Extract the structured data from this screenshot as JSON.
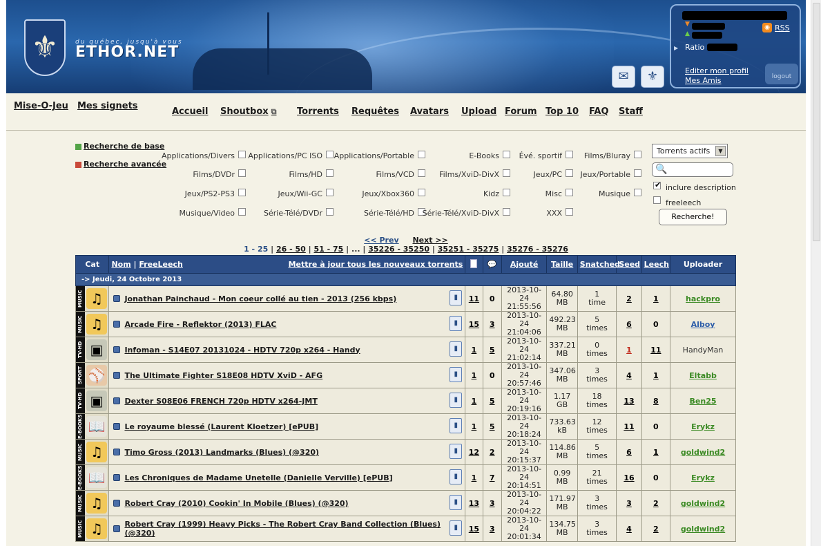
{
  "site": {
    "tagline": "du québec, jusqu'à vous",
    "logo": "ETHOR.NET",
    "emblem_icon": "fleur-de-lis-icon"
  },
  "user_panel": {
    "rss_label": "RSS",
    "ratio_label": "Ratio",
    "edit_profile": "Editer mon profil",
    "friends": "Mes Amis",
    "logout": "logout"
  },
  "nav": {
    "left": [
      "Mise-O-Jeu",
      "Mes signets"
    ],
    "main": [
      "Accueil",
      "Shoutbox",
      "Torrents",
      "Requêtes",
      "Avatars",
      "Upload",
      "Forum",
      "Top 10",
      "FAQ",
      "Staff"
    ]
  },
  "search": {
    "basic": "Recherche de base",
    "advanced": "Recherche avancée",
    "categories": [
      "Applications/Divers",
      "Applications/PC ISO",
      "Applications/Portable",
      "E-Books",
      "Évé. sportif",
      "Films/Bluray",
      "Films/DVDr",
      "Films/HD",
      "Films/VCD",
      "Films/XviD-DivX",
      "Jeux/PC",
      "Jeux/Portable",
      "Jeux/PS2-PS3",
      "Jeux/Wii-GC",
      "Jeux/Xbox360",
      "Kidz",
      "Misc",
      "Musique",
      "Musique/Video",
      "Série-Télé/DVDr",
      "Série-Télé/HD",
      "Série-Télé/XviD-DivX",
      "XXX"
    ],
    "filter_selected": "Torrents actifs",
    "include_description": "inclure description",
    "include_description_checked": true,
    "freeleech": "freeleech",
    "freeleech_checked": false,
    "button": "Recherche!"
  },
  "pagination": {
    "prev": "<< Prev",
    "next": "Next >>",
    "current": "1 - 25",
    "pages": [
      "26 - 50",
      "51 - 75"
    ],
    "ellipsis": "...",
    "last_pages": [
      "35226 - 35250",
      "35251 - 35275",
      "35276 - 35276"
    ]
  },
  "table": {
    "headers": {
      "cat": "Cat",
      "name": "Nom",
      "freeleech": "FreeLeech",
      "mark_all": "Mettre à jour tous les nouveaux torrents",
      "added": "Ajouté",
      "size": "Taille",
      "snatched": "Snatched",
      "seed": "Seed",
      "leech": "Leech",
      "uploader": "Uploader"
    },
    "date_group": "-> Jeudi, 24 Octobre 2013",
    "rows": [
      {
        "cat": "MUSIC",
        "icon": "music-note-icon",
        "name": "Jonathan Painchaud - Mon coeur collé au tien - 2013 (256 kbps)",
        "files": "11",
        "comments": "0",
        "date": "2013-10-24",
        "time": "21:55:56",
        "size": "64.80",
        "unit": "MB",
        "snatched": "1",
        "snatched_unit": "time",
        "seed": "2",
        "leech": "1",
        "uploader": "hackpro",
        "uploader_style": "green"
      },
      {
        "cat": "MUSIC",
        "icon": "music-note-icon",
        "name": "Arcade Fire - Reflektor (2013) FLAC",
        "files": "15",
        "comments": "3",
        "date": "2013-10-24",
        "time": "21:04:06",
        "size": "492.23",
        "unit": "MB",
        "snatched": "5",
        "snatched_unit": "times",
        "seed": "6",
        "leech": "0",
        "uploader": "Alboy",
        "uploader_style": "blue"
      },
      {
        "cat": "TV-HD",
        "icon": "tv-icon",
        "name": "Infoman - S14E07 20131024 - HDTV 720p x264 - Handy",
        "files": "1",
        "comments": "5",
        "date": "2013-10-24",
        "time": "21:02:14",
        "size": "337.21",
        "unit": "MB",
        "snatched": "0",
        "snatched_unit": "times",
        "seed": "1",
        "leech": "11",
        "uploader": "HandyMan",
        "uploader_style": "plain",
        "seed_red": true
      },
      {
        "cat": "SPORT",
        "icon": "baseball-icon",
        "name": "The Ultimate Fighter S18E08 HDTV XviD - AFG",
        "files": "1",
        "comments": "0",
        "date": "2013-10-24",
        "time": "20:57:46",
        "size": "347.06",
        "unit": "MB",
        "snatched": "3",
        "snatched_unit": "times",
        "seed": "4",
        "leech": "1",
        "uploader": "Eltabb",
        "uploader_style": "green"
      },
      {
        "cat": "TV-HD",
        "icon": "tv-icon",
        "name": "Dexter S08E06 FRENCH 720p HDTV x264-JMT",
        "files": "1",
        "comments": "5",
        "date": "2013-10-24",
        "time": "20:19:16",
        "size": "1.17",
        "unit": "GB",
        "snatched": "18",
        "snatched_unit": "times",
        "seed": "13",
        "leech": "8",
        "uploader": "Ben25",
        "uploader_style": "green"
      },
      {
        "cat": "E-BOOKS",
        "icon": "book-icon",
        "name": "Le royaume blessé (Laurent Kloetzer) [ePUB]",
        "files": "1",
        "comments": "5",
        "date": "2013-10-24",
        "time": "20:18:24",
        "size": "733.63",
        "unit": "kB",
        "snatched": "12",
        "snatched_unit": "times",
        "seed": "11",
        "leech": "0",
        "uploader": "Erykz",
        "uploader_style": "green"
      },
      {
        "cat": "MUSIC",
        "icon": "music-note-icon",
        "name": "Timo Gross (2013) Landmarks (Blues) (@320)",
        "files": "12",
        "comments": "2",
        "date": "2013-10-24",
        "time": "20:15:37",
        "size": "114.86",
        "unit": "MB",
        "snatched": "5",
        "snatched_unit": "times",
        "seed": "6",
        "leech": "1",
        "uploader": "goldwind2",
        "uploader_style": "green"
      },
      {
        "cat": "E-BOOKS",
        "icon": "book-icon",
        "name": "Les Chroniques de Madame Unetelle (Danielle Verville) [ePUB]",
        "files": "1",
        "comments": "7",
        "date": "2013-10-24",
        "time": "20:14:51",
        "size": "0.99",
        "unit": "MB",
        "snatched": "21",
        "snatched_unit": "times",
        "seed": "16",
        "leech": "0",
        "uploader": "Erykz",
        "uploader_style": "green"
      },
      {
        "cat": "MUSIC",
        "icon": "music-note-icon",
        "name": "Robert Cray (2010) Cookin' In Mobile (Blues) (@320)",
        "files": "13",
        "comments": "3",
        "date": "2013-10-24",
        "time": "20:04:22",
        "size": "171.97",
        "unit": "MB",
        "snatched": "3",
        "snatched_unit": "times",
        "seed": "3",
        "leech": "2",
        "uploader": "goldwind2",
        "uploader_style": "green"
      },
      {
        "cat": "MUSIC",
        "icon": "music-note-icon",
        "name": "Robert Cray (1999) Heavy Picks - The Robert Cray Band Collection (Blues) (@320)",
        "files": "15",
        "comments": "3",
        "date": "2013-10-24",
        "time": "20:01:34",
        "size": "134.75",
        "unit": "MB",
        "snatched": "3",
        "snatched_unit": "times",
        "seed": "4",
        "leech": "2",
        "uploader": "goldwind2",
        "uploader_style": "green"
      }
    ]
  }
}
